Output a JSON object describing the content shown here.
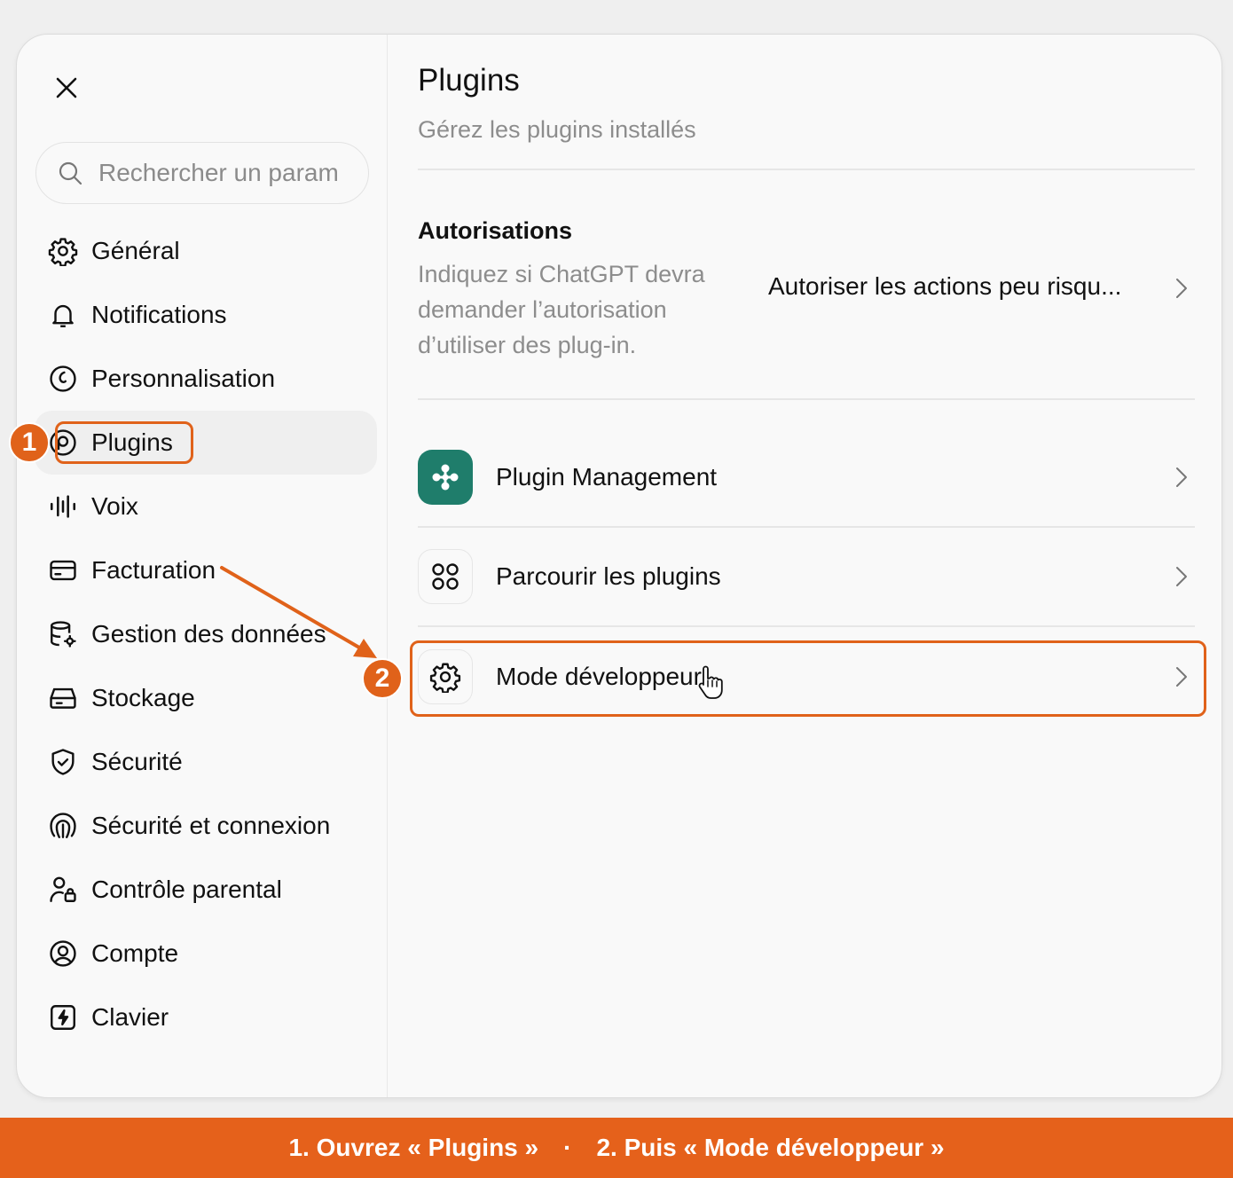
{
  "sidebar": {
    "search_placeholder": "Rechercher un param",
    "items": [
      {
        "label": "Général",
        "icon": "gear-icon"
      },
      {
        "label": "Notifications",
        "icon": "bell-icon"
      },
      {
        "label": "Personnalisation",
        "icon": "personalization-icon"
      },
      {
        "label": "Plugins",
        "icon": "plugin-icon",
        "active": true
      },
      {
        "label": "Voix",
        "icon": "voice-waveform-icon"
      },
      {
        "label": "Facturation",
        "icon": "credit-card-icon"
      },
      {
        "label": "Gestion des données",
        "icon": "database-gear-icon"
      },
      {
        "label": "Stockage",
        "icon": "storage-icon"
      },
      {
        "label": "Sécurité",
        "icon": "shield-check-icon"
      },
      {
        "label": "Sécurité et connexion",
        "icon": "fingerprint-icon"
      },
      {
        "label": "Contrôle parental",
        "icon": "parental-control-icon"
      },
      {
        "label": "Compte",
        "icon": "user-circle-icon"
      },
      {
        "label": "Clavier",
        "icon": "keyboard-bolt-icon"
      }
    ]
  },
  "main": {
    "title": "Plugins",
    "subtitle": "Gérez les plugins installés",
    "permissions": {
      "heading": "Autorisations",
      "description": "Indiquez si ChatGPT devra demander l’autorisation d’utiliser des plug-in.",
      "value": "Autoriser les actions peu risqu..."
    },
    "rows": [
      {
        "label": "Plugin Management",
        "icon": "plugin-management-icon"
      },
      {
        "label": "Parcourir les plugins",
        "icon": "grid-circles-icon"
      },
      {
        "label": "Mode développeur",
        "icon": "gear-icon"
      }
    ]
  },
  "annotations": {
    "badge_1": "1",
    "badge_2": "2",
    "accent_color": "#e0621a"
  },
  "banner": {
    "step1": "1. Ouvrez « Plugins »",
    "separator": "·",
    "step2": "2. Puis « Mode développeur »"
  }
}
